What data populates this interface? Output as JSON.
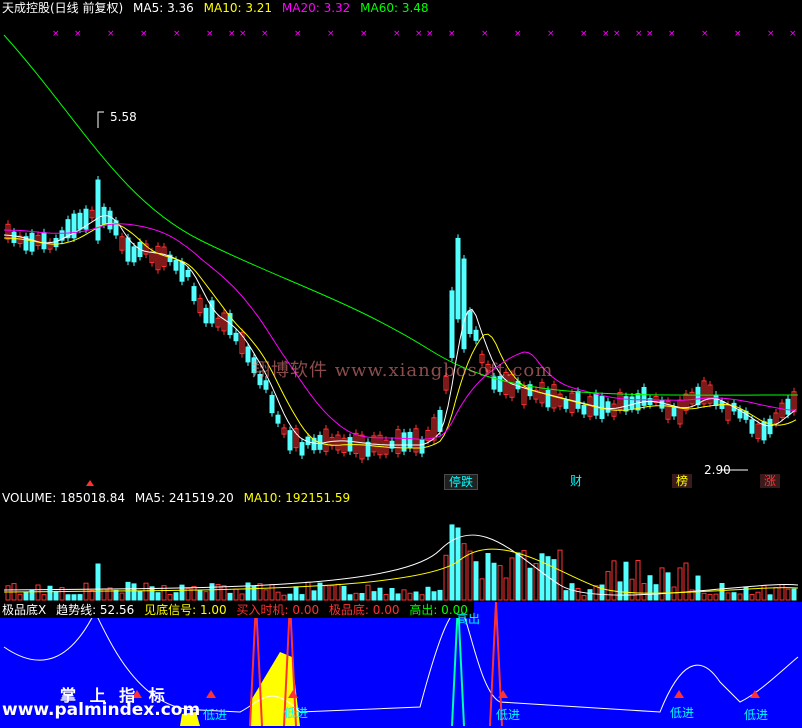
{
  "price_header": {
    "title": "天成控股(日线 前复权)",
    "ma5": "MA5: 3.36",
    "ma10": "MA10: 3.21",
    "ma20": "MA20: 3.32",
    "ma60": "MA60: 3.48"
  },
  "price_annotations": {
    "high": "5.58",
    "low": "2.90"
  },
  "event_tags": {
    "t1": "停跌",
    "t2": "财",
    "t3": "榜",
    "t4": "涨"
  },
  "watermark": "翔博软件 www.xiangbosoft.com",
  "volume_header": {
    "volume": "VOLUME: 185018.84",
    "ma5": "MA5: 241519.20",
    "ma10": "MA10: 192151.59"
  },
  "indicator_header": {
    "name": "极品底X",
    "trend": "趋势线: 52.56",
    "signal": "见底信号: 1.00",
    "buy": "买入时机: 0.00",
    "bottom": "极品底: 0.00",
    "top": "高出: 0.00"
  },
  "indicator_labels": {
    "gaochu": "高出",
    "dijin": "低进"
  },
  "branding": {
    "line1": "掌 上 指 标",
    "line2": "www.palmindex.com"
  },
  "colors": {
    "up": "#ff3232",
    "down": "#54ffff",
    "ma5": "#ffffff",
    "ma10": "#ffff00",
    "ma20": "#ff00ff",
    "ma60": "#00ff00",
    "indicator_bg": "#0000ff",
    "bottom_fill": "#ffff00"
  },
  "chart_data": {
    "type": "line",
    "title": "天成控股(日线 前复权)",
    "series": [
      {
        "name": "MA5",
        "last": 3.36
      },
      {
        "name": "MA10",
        "last": 3.21
      },
      {
        "name": "MA20",
        "last": 3.32
      },
      {
        "name": "MA60",
        "last": 3.48
      }
    ],
    "price_high": 5.58,
    "price_low": 2.9
  }
}
